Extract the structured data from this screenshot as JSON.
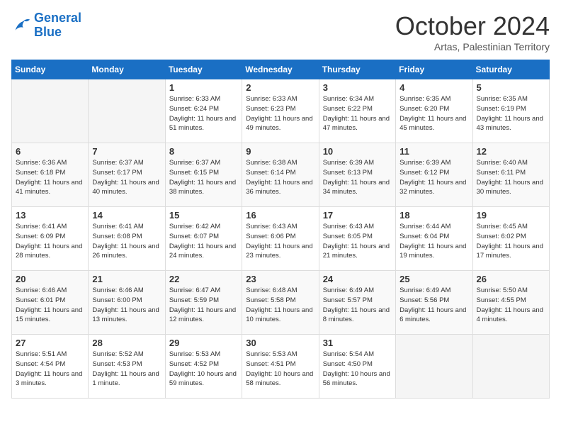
{
  "header": {
    "logo_line1": "General",
    "logo_line2": "Blue",
    "month": "October 2024",
    "location": "Artas, Palestinian Territory"
  },
  "days_of_week": [
    "Sunday",
    "Monday",
    "Tuesday",
    "Wednesday",
    "Thursday",
    "Friday",
    "Saturday"
  ],
  "weeks": [
    [
      {
        "num": "",
        "info": ""
      },
      {
        "num": "",
        "info": ""
      },
      {
        "num": "1",
        "info": "Sunrise: 6:33 AM\nSunset: 6:24 PM\nDaylight: 11 hours\nand 51 minutes."
      },
      {
        "num": "2",
        "info": "Sunrise: 6:33 AM\nSunset: 6:23 PM\nDaylight: 11 hours\nand 49 minutes."
      },
      {
        "num": "3",
        "info": "Sunrise: 6:34 AM\nSunset: 6:22 PM\nDaylight: 11 hours\nand 47 minutes."
      },
      {
        "num": "4",
        "info": "Sunrise: 6:35 AM\nSunset: 6:20 PM\nDaylight: 11 hours\nand 45 minutes."
      },
      {
        "num": "5",
        "info": "Sunrise: 6:35 AM\nSunset: 6:19 PM\nDaylight: 11 hours\nand 43 minutes."
      }
    ],
    [
      {
        "num": "6",
        "info": "Sunrise: 6:36 AM\nSunset: 6:18 PM\nDaylight: 11 hours\nand 41 minutes."
      },
      {
        "num": "7",
        "info": "Sunrise: 6:37 AM\nSunset: 6:17 PM\nDaylight: 11 hours\nand 40 minutes."
      },
      {
        "num": "8",
        "info": "Sunrise: 6:37 AM\nSunset: 6:15 PM\nDaylight: 11 hours\nand 38 minutes."
      },
      {
        "num": "9",
        "info": "Sunrise: 6:38 AM\nSunset: 6:14 PM\nDaylight: 11 hours\nand 36 minutes."
      },
      {
        "num": "10",
        "info": "Sunrise: 6:39 AM\nSunset: 6:13 PM\nDaylight: 11 hours\nand 34 minutes."
      },
      {
        "num": "11",
        "info": "Sunrise: 6:39 AM\nSunset: 6:12 PM\nDaylight: 11 hours\nand 32 minutes."
      },
      {
        "num": "12",
        "info": "Sunrise: 6:40 AM\nSunset: 6:11 PM\nDaylight: 11 hours\nand 30 minutes."
      }
    ],
    [
      {
        "num": "13",
        "info": "Sunrise: 6:41 AM\nSunset: 6:09 PM\nDaylight: 11 hours\nand 28 minutes."
      },
      {
        "num": "14",
        "info": "Sunrise: 6:41 AM\nSunset: 6:08 PM\nDaylight: 11 hours\nand 26 minutes."
      },
      {
        "num": "15",
        "info": "Sunrise: 6:42 AM\nSunset: 6:07 PM\nDaylight: 11 hours\nand 24 minutes."
      },
      {
        "num": "16",
        "info": "Sunrise: 6:43 AM\nSunset: 6:06 PM\nDaylight: 11 hours\nand 23 minutes."
      },
      {
        "num": "17",
        "info": "Sunrise: 6:43 AM\nSunset: 6:05 PM\nDaylight: 11 hours\nand 21 minutes."
      },
      {
        "num": "18",
        "info": "Sunrise: 6:44 AM\nSunset: 6:04 PM\nDaylight: 11 hours\nand 19 minutes."
      },
      {
        "num": "19",
        "info": "Sunrise: 6:45 AM\nSunset: 6:02 PM\nDaylight: 11 hours\nand 17 minutes."
      }
    ],
    [
      {
        "num": "20",
        "info": "Sunrise: 6:46 AM\nSunset: 6:01 PM\nDaylight: 11 hours\nand 15 minutes."
      },
      {
        "num": "21",
        "info": "Sunrise: 6:46 AM\nSunset: 6:00 PM\nDaylight: 11 hours\nand 13 minutes."
      },
      {
        "num": "22",
        "info": "Sunrise: 6:47 AM\nSunset: 5:59 PM\nDaylight: 11 hours\nand 12 minutes."
      },
      {
        "num": "23",
        "info": "Sunrise: 6:48 AM\nSunset: 5:58 PM\nDaylight: 11 hours\nand 10 minutes."
      },
      {
        "num": "24",
        "info": "Sunrise: 6:49 AM\nSunset: 5:57 PM\nDaylight: 11 hours\nand 8 minutes."
      },
      {
        "num": "25",
        "info": "Sunrise: 6:49 AM\nSunset: 5:56 PM\nDaylight: 11 hours\nand 6 minutes."
      },
      {
        "num": "26",
        "info": "Sunrise: 5:50 AM\nSunset: 4:55 PM\nDaylight: 11 hours\nand 4 minutes."
      }
    ],
    [
      {
        "num": "27",
        "info": "Sunrise: 5:51 AM\nSunset: 4:54 PM\nDaylight: 11 hours\nand 3 minutes."
      },
      {
        "num": "28",
        "info": "Sunrise: 5:52 AM\nSunset: 4:53 PM\nDaylight: 11 hours\nand 1 minute."
      },
      {
        "num": "29",
        "info": "Sunrise: 5:53 AM\nSunset: 4:52 PM\nDaylight: 10 hours\nand 59 minutes."
      },
      {
        "num": "30",
        "info": "Sunrise: 5:53 AM\nSunset: 4:51 PM\nDaylight: 10 hours\nand 58 minutes."
      },
      {
        "num": "31",
        "info": "Sunrise: 5:54 AM\nSunset: 4:50 PM\nDaylight: 10 hours\nand 56 minutes."
      },
      {
        "num": "",
        "info": ""
      },
      {
        "num": "",
        "info": ""
      }
    ]
  ]
}
